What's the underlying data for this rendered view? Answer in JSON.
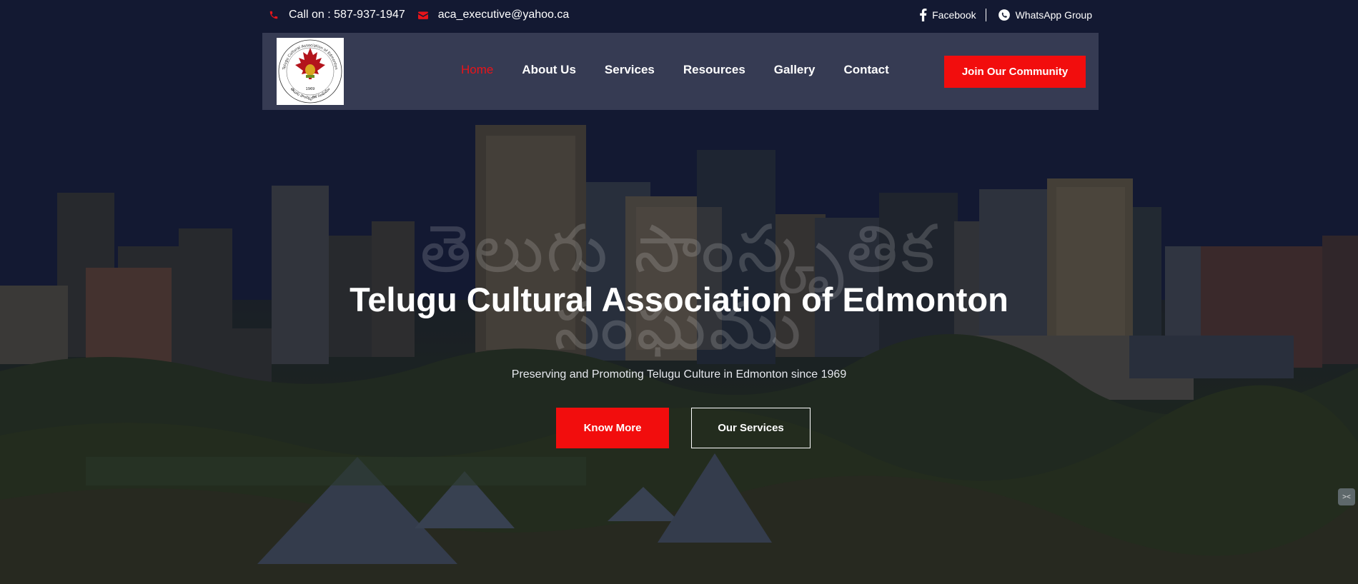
{
  "topbar": {
    "phone_text": "Call on : 587-937-1947",
    "email_text": "aca_executive@yahoo.ca",
    "facebook_label": "Facebook",
    "whatsapp_label": "WhatsApp Group",
    "icons": [
      "phone-icon",
      "envelope-icon",
      "facebook-icon",
      "whatsapp-icon"
    ]
  },
  "logo": {
    "ring_text_top": "Telugu Cultural Association of Edmonton",
    "ring_text_bottom": "తెలుగు సాంస్కృతిక సంఘము",
    "year": "1969"
  },
  "nav": {
    "items": [
      {
        "label": "Home",
        "active": true
      },
      {
        "label": "About Us",
        "active": false
      },
      {
        "label": "Services",
        "active": false
      },
      {
        "label": "Resources",
        "active": false
      },
      {
        "label": "Gallery",
        "active": false
      },
      {
        "label": "Contact",
        "active": false
      }
    ],
    "cta_label": "Join Our Community"
  },
  "hero": {
    "watermark_line1": "తెలుగు సాంస్కృతిక",
    "watermark_line2": "సంఘము",
    "title": "Telugu Cultural Association of Edmonton",
    "subtitle": "Preserving and Promoting Telugu Culture in Edmonton since 1969",
    "primary_button": "Know More",
    "secondary_button": "Our Services"
  },
  "colors": {
    "accent": "#f20d0d",
    "active_nav": "#e8141a",
    "navbar_bg": "#3e435a",
    "text": "#ffffff"
  }
}
